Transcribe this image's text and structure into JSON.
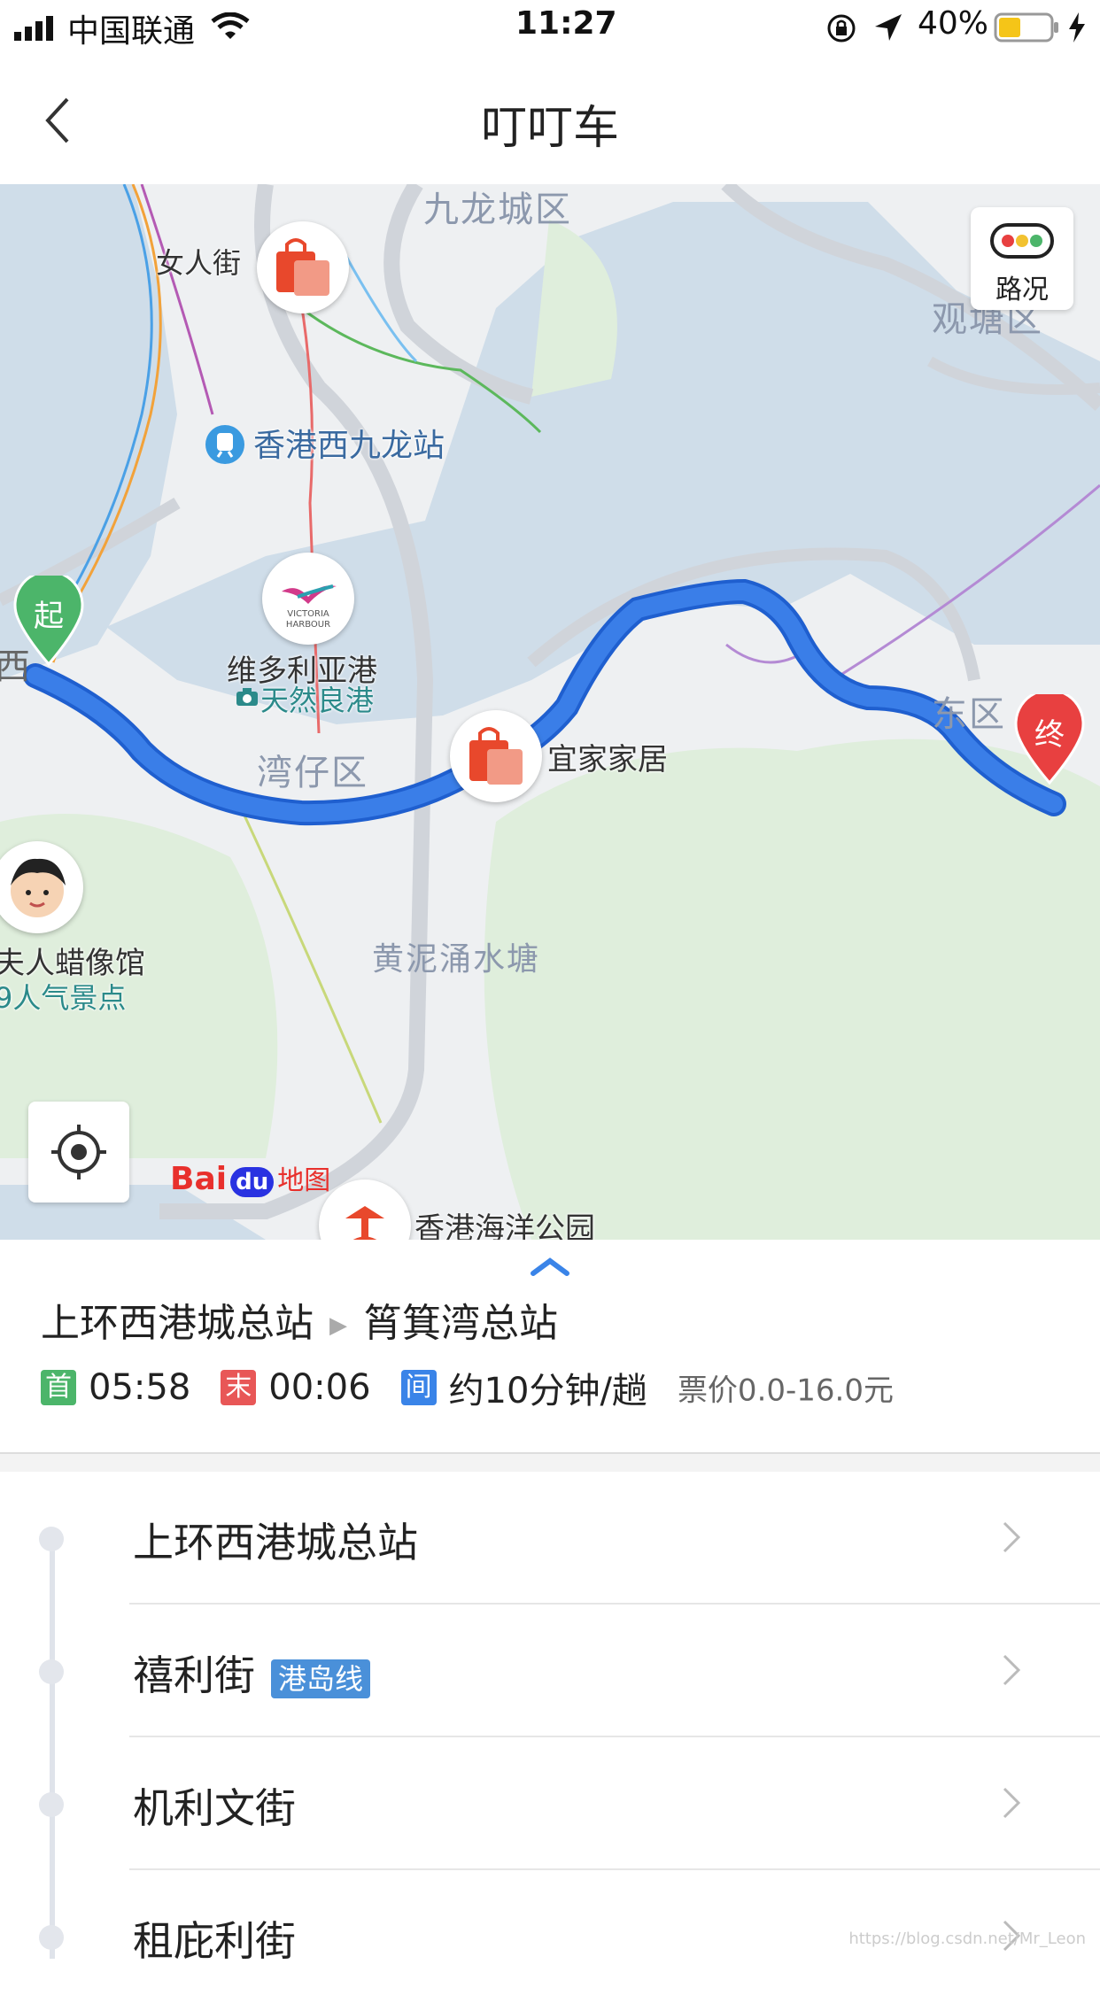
{
  "status_bar": {
    "carrier": "中国联通",
    "time": "11:27",
    "battery": "40%"
  },
  "header": {
    "title": "叮叮车"
  },
  "map": {
    "labels": {
      "womens_street": "女人街",
      "west_kowloon": "香港西九龙站",
      "victoria_harbour": "维多利亚港",
      "victoria_sub": "天然良港",
      "victoria_logo": "VICTORIA HARBOUR",
      "wan_chai": "湾仔区",
      "ikea": "宜家家居",
      "east_district": "东区",
      "kowloon_city": "九龙城区",
      "kwun_tong": "观塘区",
      "wong_nai_chung": "黄泥涌水塘",
      "wax_museum": "夫人蜡像馆",
      "wax_sub": "9人气景点",
      "ocean_park": "香港海洋公园",
      "west_edge": "西",
      "start_marker": "起",
      "end_marker": "终",
      "traffic_label": "路况",
      "logo_bai": "Bai",
      "logo_du": "du",
      "logo_map": "地图"
    }
  },
  "line_info": {
    "from": "上环西港城总站",
    "to": "筲箕湾总站",
    "first_tag": "首",
    "first_time": "05:58",
    "last_tag": "末",
    "last_time": "00:06",
    "interval_tag": "间",
    "interval": "约10分钟/趟",
    "fare": "票价0.0-16.0元"
  },
  "stops": [
    {
      "name": "上环西港城总站",
      "badge": ""
    },
    {
      "name": "禧利街",
      "badge": "港岛线"
    },
    {
      "name": "机利文街",
      "badge": ""
    },
    {
      "name": "租庇利街",
      "badge": ""
    }
  ],
  "watermark": "https://blog.csdn.net/Mr_Leon",
  "colors": {
    "route": "#3a7ee8",
    "first": "#4cb56a",
    "last": "#e85757",
    "interval": "#3a84e8",
    "start_pin": "#4cb56a",
    "end_pin": "#e84040",
    "water": "#cfdde9",
    "green": "#dfeedc"
  }
}
